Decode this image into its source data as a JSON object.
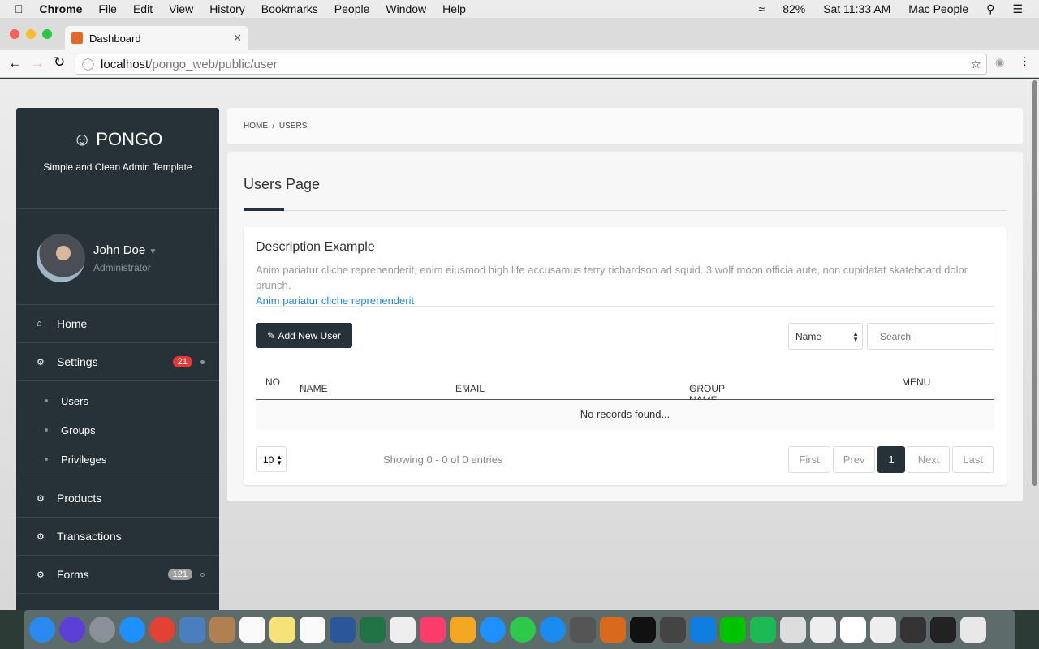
{
  "menubar": {
    "app": "Chrome",
    "items": [
      "File",
      "Edit",
      "View",
      "History",
      "Bookmarks",
      "People",
      "Window",
      "Help"
    ],
    "battery": "82%",
    "clock": "Sat 11:33 AM",
    "user": "Mac People"
  },
  "browser": {
    "tab_title": "Dashboard",
    "url_host": "localhost",
    "url_path": "/pongo_web/public/user"
  },
  "sidebar": {
    "brand": "PONGO",
    "tagline": "Simple and Clean Admin Template",
    "user_name": "John Doe",
    "user_role": "Administrator",
    "items": [
      {
        "label": "Home",
        "icon": "home-icon"
      },
      {
        "label": "Settings",
        "icon": "gear-icon",
        "badge": "21"
      }
    ],
    "subitems": [
      "Users",
      "Groups",
      "Privileges"
    ],
    "items2": [
      {
        "label": "Products"
      },
      {
        "label": "Transactions"
      },
      {
        "label": "Forms",
        "badge": "121"
      }
    ],
    "badge_color": "#e53935"
  },
  "breadcrumb": [
    "HOME",
    "USERS"
  ],
  "page": {
    "title": "Users Page",
    "card_title": "Description Example",
    "description": "Anim pariatur cliche reprehenderit, enim eiusmod high life accusamus terry richardson ad squid. 3 wolf moon officia aute, non cupidatat skateboard dolor brunch.",
    "link": "Anim pariatur cliche reprehenderit",
    "add_button": "Add New User",
    "filter_select": "Name",
    "search_placeholder": "Search",
    "columns": [
      "NO",
      "NAME",
      "EMAIL",
      "GROUP NAME",
      "MENU"
    ],
    "empty": "No records found...",
    "page_size": "10",
    "info": "Showing 0 - 0 of 0 entries",
    "pagination": [
      "First",
      "Prev",
      "1",
      "Next",
      "Last"
    ]
  },
  "dock": {
    "colors": [
      "#2a8af0",
      "#5b3fd6",
      "#8a9199",
      "#1e90ff",
      "#e34133",
      "#4a7fbf",
      "#b08050",
      "#fafafa",
      "#f7e27a",
      "#fafafa",
      "#2b579a",
      "#217346",
      "#eeeeee",
      "#fc3c6a",
      "#f5a623",
      "#1e90ff",
      "#2ec84a",
      "#1a8cf0",
      "#555",
      "#d96a1b",
      "#111",
      "#444",
      "#0e7ee0",
      "#00c300",
      "#1db954",
      "#ddd",
      "#eee",
      "#fff",
      "#eee",
      "#333",
      "#222",
      "#e8e8e8"
    ]
  }
}
